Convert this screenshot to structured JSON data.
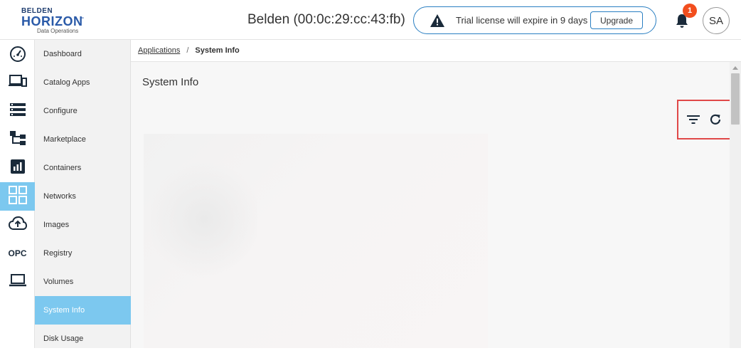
{
  "logo": {
    "line1": "BELDEN",
    "line2": "HORIZON",
    "tm": "™",
    "line3": "Data Operations"
  },
  "header": {
    "device_title": "Belden (00:0c:29:cc:43:fb)",
    "trial_text": "Trial license will expire in 9 days",
    "upgrade_label": "Upgrade",
    "notification_count": "1",
    "avatar_initials": "SA"
  },
  "iconbar": {
    "items": [
      {
        "icon": "gauge-icon"
      },
      {
        "icon": "devices-icon"
      },
      {
        "icon": "list-icon"
      },
      {
        "icon": "hierarchy-icon"
      },
      {
        "icon": "chart-icon"
      },
      {
        "icon": "grid-icon",
        "active": true
      },
      {
        "icon": "cloud-upload-icon"
      },
      {
        "icon": "opc-icon",
        "label": "OPC"
      },
      {
        "icon": "laptop-icon"
      }
    ]
  },
  "menu": {
    "items": [
      {
        "label": "Dashboard"
      },
      {
        "label": "Catalog Apps"
      },
      {
        "label": "Configure"
      },
      {
        "label": "Marketplace"
      },
      {
        "label": "Containers"
      },
      {
        "label": "Networks"
      },
      {
        "label": "Images"
      },
      {
        "label": "Registry"
      },
      {
        "label": "Volumes"
      },
      {
        "label": "System Info",
        "active": true
      },
      {
        "label": "Disk Usage"
      }
    ]
  },
  "breadcrumb": {
    "parent": "Applications",
    "separator": "/",
    "current": "System Info"
  },
  "page": {
    "title": "System Info"
  },
  "colors": {
    "accent": "#7cc8ef",
    "brand": "#2a5aa8",
    "alert": "#f24e1e",
    "highlight": "#e04848",
    "border": "#2a7fc2"
  }
}
